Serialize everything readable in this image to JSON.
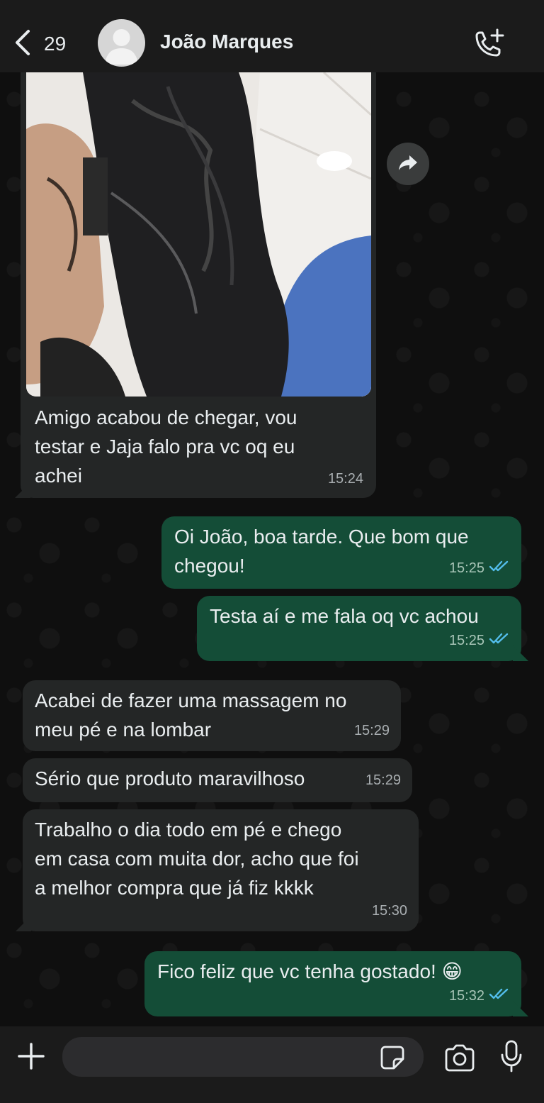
{
  "header": {
    "back_count": "29",
    "contact_name": "João Marques"
  },
  "messages": [
    {
      "direction": "in",
      "type": "image",
      "caption": "Amigo acabou de chegar, vou\ntestar e Jaja falo pra vc oq eu\nachei",
      "time": "15:24"
    },
    {
      "direction": "out",
      "text": "Oi João, boa tarde. Que bom que\nchegou!",
      "time": "15:25",
      "status": "read"
    },
    {
      "direction": "out",
      "text": "Testa aí e me fala oq vc achou",
      "time": "15:25",
      "status": "read"
    },
    {
      "direction": "in",
      "text": "Acabei de fazer uma massagem no\nmeu pé e na lombar",
      "time": "15:29"
    },
    {
      "direction": "in",
      "text": "Sério que produto maravilhoso",
      "time": "15:29"
    },
    {
      "direction": "in",
      "text": "Trabalho o dia todo em pé e chego\nem casa com muita dor, acho que foi\na melhor compra que já fiz kkkk",
      "time": "15:30"
    },
    {
      "direction": "out",
      "text": "Fico feliz que vc tenha gostado! 😁",
      "time": "15:32",
      "status": "read"
    }
  ],
  "input": {
    "placeholder": ""
  },
  "icons": {
    "back": "chevron-left-icon",
    "call": "phone-plus-icon",
    "forward": "forward-arrow-icon",
    "plus": "plus-icon",
    "sticker": "sticker-icon",
    "camera": "camera-icon",
    "mic": "microphone-icon",
    "ticks": "double-check-icon"
  },
  "colors": {
    "incoming_bubble": "#242626",
    "outgoing_bubble": "#144d37",
    "read_ticks": "#53bdeb",
    "header": "#1b1b1b"
  }
}
